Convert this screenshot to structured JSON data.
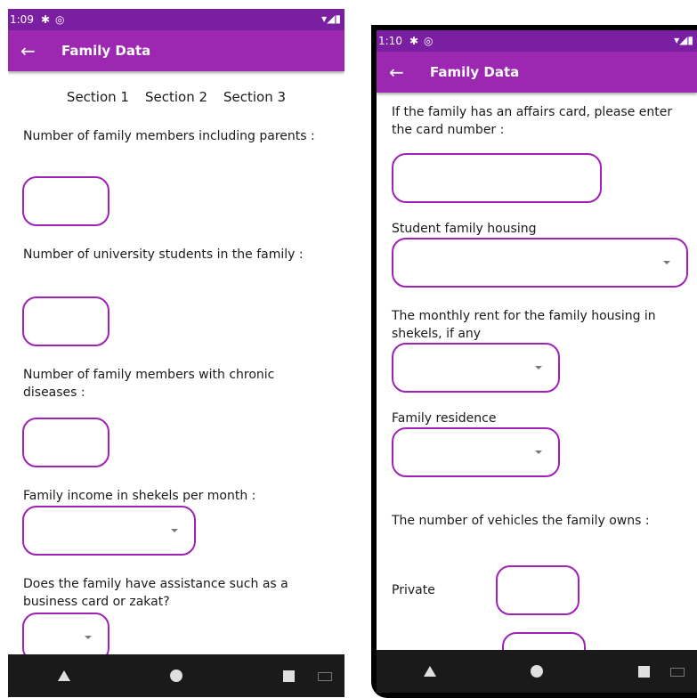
{
  "left_screen": {
    "status": {
      "time": "1:09"
    },
    "appbar": {
      "title": "Family Data"
    },
    "tabs": [
      "Section 1",
      "Section 2",
      "Section 3"
    ],
    "fields": {
      "members_label": "Number of family members including parents :",
      "students_label": "Number of university students in the family :",
      "chronic_label": "Number of family members with chronic diseases :",
      "income_label": "Family income in shekels per month :",
      "assistance_label": "Does the family have assistance such as a business card or zakat?"
    }
  },
  "right_screen": {
    "status": {
      "time": "1:10"
    },
    "appbar": {
      "title": "Family Data"
    },
    "fields": {
      "affairs_label": "If the family has an affairs card, please enter the card number :",
      "housing_label": "Student family housing",
      "rent_label": "The monthly rent for the family housing in shekels, if any",
      "residence_label": "Family residence",
      "vehicles_label": "The number of vehicles the family owns :",
      "private_label": "Private"
    }
  },
  "colors": {
    "statusbar": "#7b1fa2",
    "appbar": "#9c27b0",
    "field_border": "#a021b5"
  }
}
